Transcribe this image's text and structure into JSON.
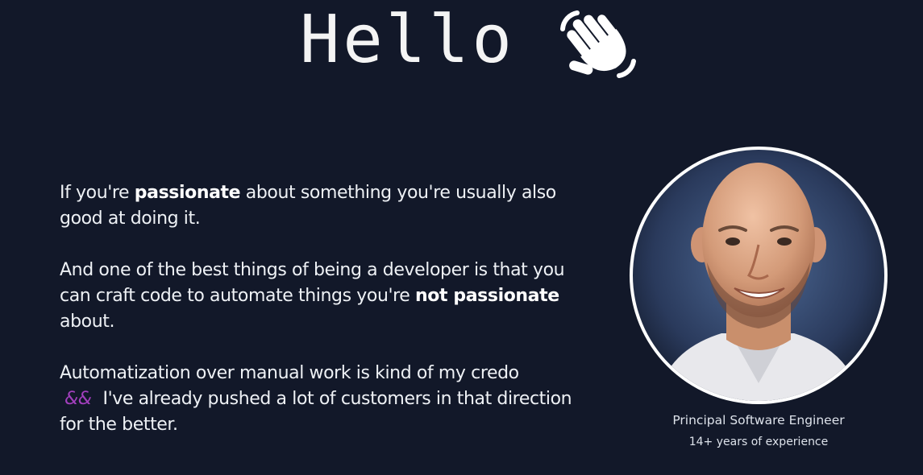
{
  "hero": {
    "title": "Hello",
    "icon": "waving-hand-icon"
  },
  "intro": {
    "p1_before": "If you're ",
    "p1_bold": "passionate",
    "p1_after": " about something you're usually also good at doing it.",
    "p2_before": "And one of the best things of being a developer is that you can craft code to automate things you're ",
    "p2_bold": "not passionate",
    "p2_after": " about.",
    "p3_line1": "Automatization over manual work is kind of my credo",
    "p3_amp": "&&",
    "p3_rest": "I've already pushed a lot of customers in that direction for the better."
  },
  "profile": {
    "photo": "profile-photo",
    "role": "Principal Software Engineer",
    "experience": "14+ years of experience"
  },
  "colors": {
    "background": "#121829",
    "text": "#eef1f5",
    "accent": "#a23fbd"
  }
}
